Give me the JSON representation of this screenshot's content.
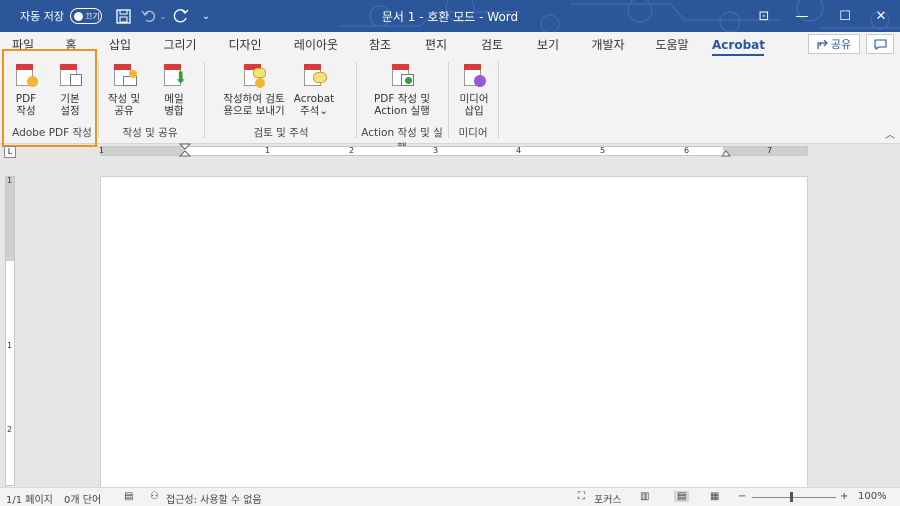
{
  "titlebar": {
    "autosave_label": "자동 저장",
    "autosave_toggle": "끄기",
    "title": "문서 1 - 호환 모드 - Word",
    "qat": {
      "save_icon": "save-icon",
      "undo_icon": "undo-icon",
      "redo_icon": "redo-icon",
      "customize_icon": "chevron-down-icon"
    },
    "window": {
      "ribbon_display": "⊡",
      "minimize": "—",
      "maximize": "☐",
      "close": "✕"
    }
  },
  "tabs": [
    {
      "label": "파일"
    },
    {
      "label": "홈"
    },
    {
      "label": "삽입"
    },
    {
      "label": "그리기"
    },
    {
      "label": "디자인"
    },
    {
      "label": "레이아웃"
    },
    {
      "label": "참조"
    },
    {
      "label": "편지"
    },
    {
      "label": "검토"
    },
    {
      "label": "보기"
    },
    {
      "label": "개발자"
    },
    {
      "label": "도움말"
    },
    {
      "label": "Acrobat"
    }
  ],
  "share_label": "공유",
  "ribbon": {
    "buttons": [
      {
        "line1": "PDF",
        "line2": "작성",
        "icon": "create-pdf-icon"
      },
      {
        "line1": "기본",
        "line2": "설정",
        "icon": "preferences-icon"
      },
      {
        "line1": "작성 및",
        "line2": "공유",
        "icon": "create-and-share-icon"
      },
      {
        "line1": "메일",
        "line2": "병합",
        "icon": "mail-merge-icon"
      },
      {
        "line1": "작성하여 검토",
        "line2": "용으로 보내기",
        "icon": "send-for-review-icon"
      },
      {
        "line1": "Acrobat",
        "line2": "주석⌄",
        "icon": "acrobat-comment-icon"
      },
      {
        "line1": "PDF 작성 및",
        "line2": "Action 실행",
        "icon": "create-pdf-run-action-icon"
      },
      {
        "line1": "미디어",
        "line2": "삽입",
        "icon": "insert-media-icon"
      }
    ],
    "groups": [
      {
        "label": "Adobe PDF 작성"
      },
      {
        "label": "작성 및 공유"
      },
      {
        "label": "검토 및 주석"
      },
      {
        "label": "Action 작성 및 실행"
      },
      {
        "label": "미디어"
      }
    ]
  },
  "ruler": {
    "corner": "L",
    "h_numbers": [
      "1",
      "1",
      "2",
      "3",
      "4",
      "5",
      "6",
      "7"
    ],
    "v_numbers": [
      "1",
      "1",
      "2"
    ]
  },
  "status": {
    "page": "1/1 페이지",
    "words": "0개 단어",
    "accessibility": "접근성: 사용할 수 없음",
    "focus": "포커스",
    "zoom_minus": "−",
    "zoom_plus": "+",
    "zoom": "100%"
  },
  "colors": {
    "accent": "#2b579a",
    "highlight": "#f0921c",
    "pdf_red": "#d83b3b"
  }
}
